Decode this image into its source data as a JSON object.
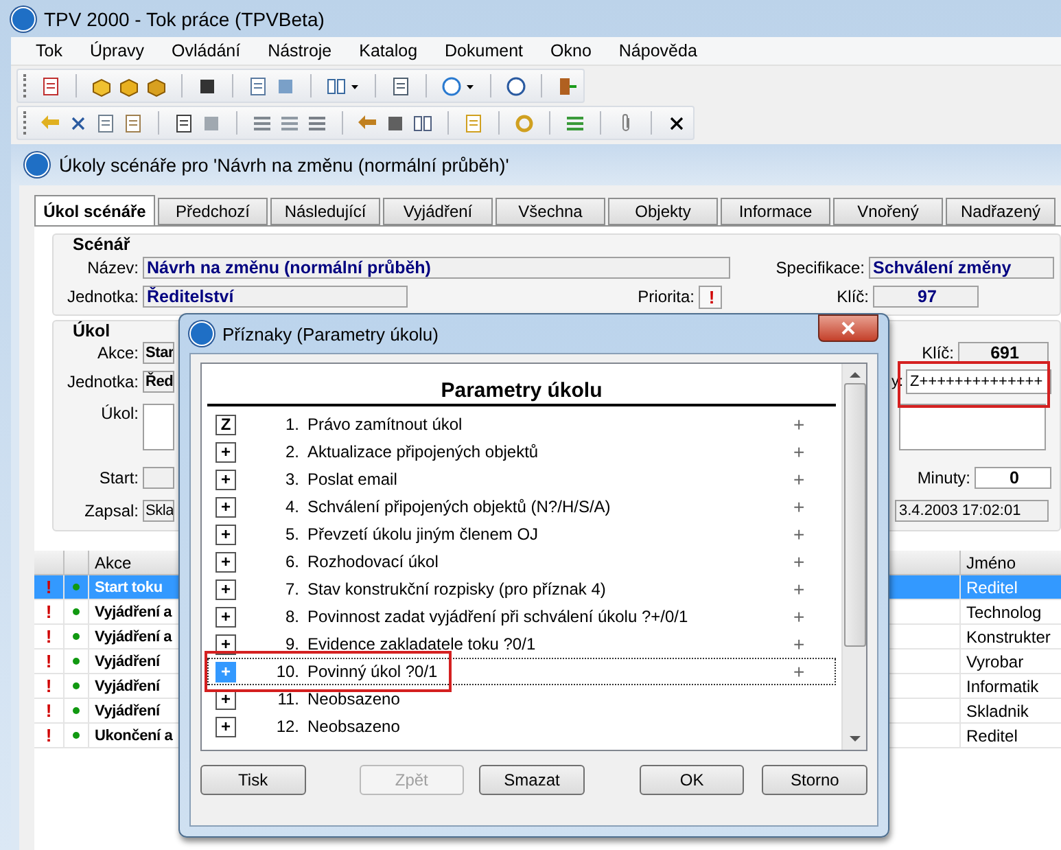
{
  "window": {
    "title": "TPV 2000 - Tok práce (TPVBeta)"
  },
  "menu": [
    "Tok",
    "Úpravy",
    "Ovládání",
    "Nástroje",
    "Katalog",
    "Dokument",
    "Okno",
    "Nápověda"
  ],
  "document": {
    "title": "Úkoly scénáře pro 'Návrh na změnu (normální průběh)'",
    "tabs": [
      {
        "label": "Úkol scénáře",
        "selected": true
      },
      {
        "label": "Předchozí",
        "selected": false
      },
      {
        "label": "Následující",
        "selected": false
      },
      {
        "label": "Vyjádření",
        "selected": false
      },
      {
        "label": "Všechna",
        "selected": false
      },
      {
        "label": "Objekty",
        "selected": false
      },
      {
        "label": "Informace",
        "selected": false
      },
      {
        "label": "Vnořený",
        "selected": false
      },
      {
        "label": "Nadřazený",
        "selected": false
      }
    ],
    "scenario": {
      "title": "Scénář",
      "name_label": "Název:",
      "name": "Návrh na změnu (normální průběh)",
      "spec_label": "Specifikace:",
      "spec": "Schválení změny",
      "unit_label": "Jednotka:",
      "unit": "Ředitelství",
      "priority_label": "Priorita:",
      "priority": "!",
      "key_label": "Klíč:",
      "key": "97"
    },
    "task": {
      "title": "Úkol",
      "action_label": "Akce:",
      "action": "Star",
      "key_label": "Klíč:",
      "key": "691",
      "unit_label": "Jednotka:",
      "unit": "Řed",
      "flags_label": "y:",
      "flags": "Z++++++++++++++",
      "flags_highlighted": true,
      "task_label": "Úkol:",
      "start_label": "Start:",
      "minutes_label": "Minuty:",
      "minutes": "0",
      "author_label": "Zapsal:",
      "author": "Skla",
      "created": "3.4.2003 17:02:01"
    },
    "table": {
      "columns": [
        "Akce",
        "Jméno"
      ],
      "rows": [
        {
          "priority": "!",
          "action": "Start toku",
          "name": "Reditel",
          "selected": true
        },
        {
          "priority": "!",
          "action": "Vyjádření a",
          "name": "Technolog",
          "selected": false
        },
        {
          "priority": "!",
          "action": "Vyjádření a",
          "name": "Konstrukter",
          "selected": false
        },
        {
          "priority": "!",
          "action": "Vyjádření",
          "name": "Vyrobar",
          "selected": false
        },
        {
          "priority": "!",
          "action": "Vyjádření",
          "name": "Informatik",
          "selected": false
        },
        {
          "priority": "!",
          "action": "Vyjádření",
          "name": "Skladnik",
          "selected": false
        },
        {
          "priority": "!",
          "action": "Ukončení a",
          "name": "Reditel",
          "selected": false
        }
      ]
    }
  },
  "dialog": {
    "title": "Příznaky (Parametry úkolu)",
    "list_title": "Parametry úkolu",
    "items": [
      {
        "key": "Z",
        "number": "1.",
        "label": "Právo zamítnout úkol",
        "value": "+",
        "selected": false,
        "highlighted": false
      },
      {
        "key": "+",
        "number": "2.",
        "label": "Aktualizace připojených objektů",
        "value": "+",
        "selected": false,
        "highlighted": false
      },
      {
        "key": "+",
        "number": "3.",
        "label": "Poslat email",
        "value": "+",
        "selected": false,
        "highlighted": false
      },
      {
        "key": "+",
        "number": "4.",
        "label": "Schválení připojených objektů (N?/H/S/A)",
        "value": "+",
        "selected": false,
        "highlighted": false
      },
      {
        "key": "+",
        "number": "5.",
        "label": "Převzetí úkolu jiným členem OJ",
        "value": "+",
        "selected": false,
        "highlighted": false
      },
      {
        "key": "+",
        "number": "6.",
        "label": "Rozhodovací úkol",
        "value": "+",
        "selected": false,
        "highlighted": false
      },
      {
        "key": "+",
        "number": "7.",
        "label": "Stav konstrukční rozpisky (pro příznak 4)",
        "value": "+",
        "selected": false,
        "highlighted": false
      },
      {
        "key": "+",
        "number": "8.",
        "label": "Povinnost zadat vyjádření při schválení úkolu ?+/0/1",
        "value": "+",
        "selected": false,
        "highlighted": false
      },
      {
        "key": "+",
        "number": "9.",
        "label": "Evidence zakladatele toku ?0/1",
        "value": "+",
        "selected": false,
        "highlighted": false
      },
      {
        "key": "+",
        "number": "10.",
        "label": "Povinný úkol ?0/1",
        "value": "+",
        "selected": true,
        "highlighted": true
      },
      {
        "key": "+",
        "number": "11.",
        "label": "Neobsazeno",
        "selected": false,
        "highlighted": false
      },
      {
        "key": "+",
        "number": "12.",
        "label": "Neobsazeno",
        "selected": false,
        "highlighted": false
      }
    ],
    "buttons": [
      {
        "label": "Tisk",
        "disabled": false
      },
      {
        "label": "Zpět",
        "disabled": true
      },
      {
        "label": "Smazat",
        "disabled": false
      },
      {
        "label": "OK",
        "disabled": false
      },
      {
        "label": "Storno",
        "disabled": false
      }
    ]
  }
}
